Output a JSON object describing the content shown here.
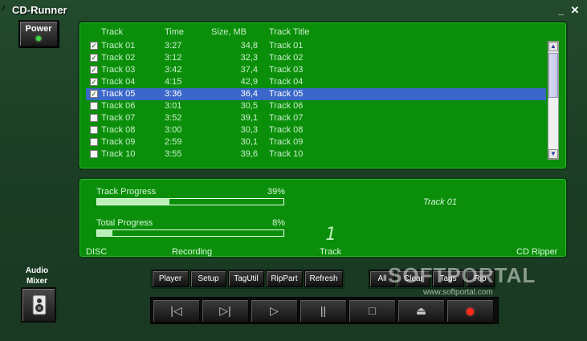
{
  "window": {
    "title": "CD-Runner",
    "minimize_glyph": "_",
    "close_glyph": "✕",
    "app_icon": "music-note-icon"
  },
  "power": {
    "label": "Power",
    "led_color": "#3fdc3f"
  },
  "tracklist": {
    "columns": {
      "track": "Track",
      "time": "Time",
      "size": "Size, MB",
      "title": "Track Title"
    },
    "rows": [
      {
        "checked": true,
        "track": "Track 01",
        "time": "3:27",
        "size": "34,8",
        "title": "Track 01",
        "selected": false
      },
      {
        "checked": true,
        "track": "Track 02",
        "time": "3:12",
        "size": "32,3",
        "title": "Track 02",
        "selected": false
      },
      {
        "checked": true,
        "track": "Track 03",
        "time": "3:42",
        "size": "37,4",
        "title": "Track 03",
        "selected": false
      },
      {
        "checked": true,
        "track": "Track 04",
        "time": "4:15",
        "size": "42,9",
        "title": "Track 04",
        "selected": false
      },
      {
        "checked": true,
        "track": "Track 05",
        "time": "3:36",
        "size": "36,4",
        "title": "Track 05",
        "selected": true
      },
      {
        "checked": false,
        "track": "Track 06",
        "time": "3:01",
        "size": "30,5",
        "title": "Track 06",
        "selected": false
      },
      {
        "checked": false,
        "track": "Track 07",
        "time": "3:52",
        "size": "39,1",
        "title": "Track 07",
        "selected": false
      },
      {
        "checked": false,
        "track": "Track 08",
        "time": "3:00",
        "size": "30,3",
        "title": "Track 08",
        "selected": false
      },
      {
        "checked": false,
        "track": "Track 09",
        "time": "2:59",
        "size": "30,1",
        "title": "Track 09",
        "selected": false
      },
      {
        "checked": false,
        "track": "Track 10",
        "time": "3:55",
        "size": "39,6",
        "title": "Track 10",
        "selected": false
      }
    ]
  },
  "progress": {
    "track_label": "Track Progress",
    "track_pct_text": "39%",
    "track_fraction": 0.39,
    "total_label": "Total Progress",
    "total_pct_text": "8%",
    "total_fraction": 0.08,
    "current_track": "Track 01",
    "track_digit": "1",
    "status": {
      "disc": "DISC",
      "recording": "Recording",
      "track": "Track",
      "mode": "CD Ripper"
    }
  },
  "mixer": {
    "label_line1": "Audio",
    "label_line2": "Mixer",
    "icon": "speaker-icon"
  },
  "toolbar": {
    "buttons": [
      "Player",
      "Setup",
      "TagUtil",
      "RipPart",
      "Refresh"
    ],
    "select_buttons": [
      "All",
      "Clear",
      "Tags",
      "Rip"
    ]
  },
  "transport": {
    "buttons": [
      {
        "name": "prev-button",
        "glyph": "|◁"
      },
      {
        "name": "next-button",
        "glyph": "▷|"
      },
      {
        "name": "play-button",
        "glyph": "▷"
      },
      {
        "name": "pause-button",
        "glyph": "||"
      },
      {
        "name": "stop-button",
        "glyph": "□"
      },
      {
        "name": "eject-button",
        "glyph": "⏏"
      },
      {
        "name": "record-button",
        "glyph": ""
      }
    ],
    "record_color": "#ff2a1a"
  },
  "watermark": {
    "text": "SOFTPORTAL",
    "url": "www.softportal.com"
  },
  "colors": {
    "panel_green": "#0b8f0b",
    "selection_blue": "#3a67c9",
    "window_green": "#1e3a24"
  }
}
